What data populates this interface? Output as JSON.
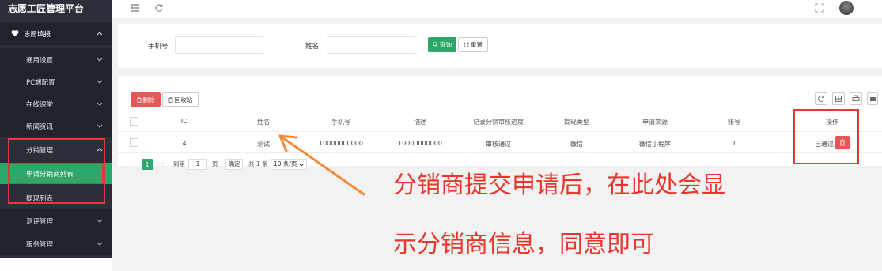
{
  "sidebar": {
    "logo": "志愿工匠管理平台",
    "items": [
      {
        "label": "志愿填报"
      },
      {
        "label": "通用设置"
      },
      {
        "label": "PC端配置"
      },
      {
        "label": "在线课堂"
      },
      {
        "label": "新闻资讯"
      },
      {
        "label": "分销管理"
      },
      {
        "label": "申请分销商列表"
      },
      {
        "label": "提现列表"
      },
      {
        "label": "测评管理"
      },
      {
        "label": "服务管理"
      }
    ]
  },
  "search": {
    "phone_label": "手机号",
    "name_label": "姓名",
    "search_button": "查询",
    "reset_button": "重置"
  },
  "toolbar": {
    "delete_button": "删除",
    "recycle_button": "回收站"
  },
  "table": {
    "columns": [
      "ID",
      "姓名",
      "手机号",
      "描述",
      "记录分销审核进度",
      "提现类型",
      "申请来源",
      "账号",
      "操作"
    ],
    "rows": [
      {
        "id": "4",
        "name": "测试",
        "phone": "10000000000",
        "desc": "10000000000",
        "progress": "审核通过",
        "withdraw_type": "微信",
        "source": "微信小程序",
        "account": "1",
        "status": "已通过"
      }
    ]
  },
  "pagination": {
    "current": "1",
    "goto_label": "到第",
    "goto_value": "1",
    "page_unit": "页",
    "confirm": "确定",
    "total": "共 1 条",
    "page_size": "10 条/页"
  },
  "annotation": {
    "line1": "分销商提交申请后，在此处会显",
    "line2": "示分销商信息，同意即可",
    "color": "#e8362d",
    "arrow_color": "#f08a3c"
  },
  "colors": {
    "sidebar_bg": "#2b2f3a",
    "accent": "#2ea76a",
    "danger": "#e75656"
  }
}
